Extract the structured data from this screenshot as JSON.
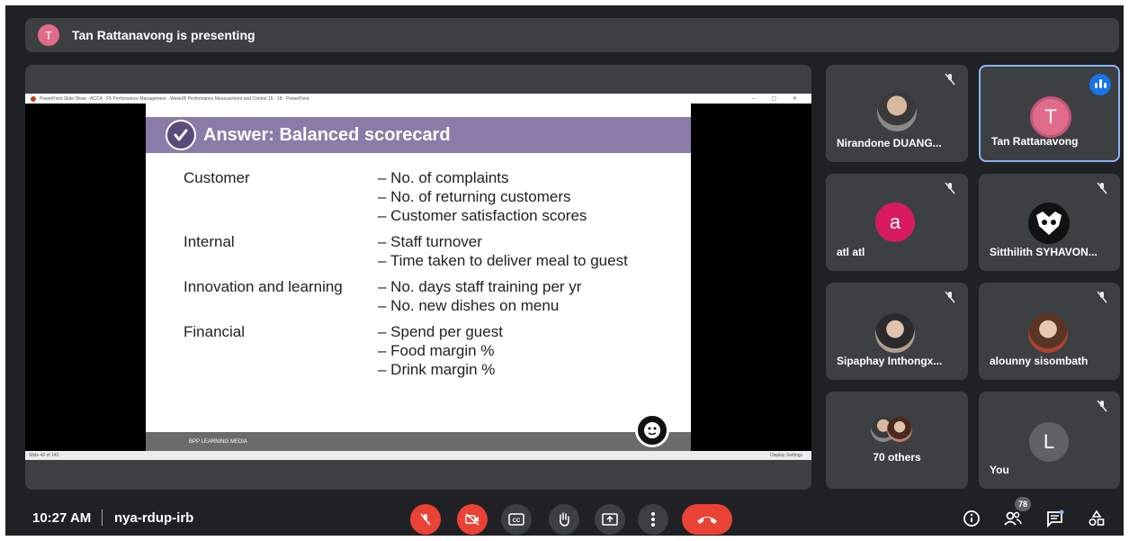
{
  "banner": {
    "avatar_letter": "T",
    "text": "Tan Rattanavong is presenting"
  },
  "ppt": {
    "window_title": "PowerPoint Slide Show  -  ACCA - F5 Performance Management - Week05 Performance Measurement and Control 16 - 18  -  PowerPoint",
    "window_controls": "–  ▢  ✕",
    "status_left": "Slide 42 of 142",
    "status_right": "Display Settings"
  },
  "slide": {
    "title": "Answer: Balanced scorecard",
    "rows": [
      {
        "category": "Customer",
        "items": [
          "– No. of complaints",
          "– No. of returning customers",
          "– Customer satisfaction scores"
        ]
      },
      {
        "category": "Internal",
        "items": [
          "– Staff turnover",
          "– Time taken to deliver meal to guest"
        ]
      },
      {
        "category": "Innovation and learning",
        "items": [
          "– No. days staff training per yr",
          "– No. new dishes on menu"
        ]
      },
      {
        "category": "Financial",
        "items": [
          "– Spend per guest",
          "– Food margin %",
          "– Drink margin %"
        ]
      }
    ],
    "footer": "BPP LEARNING MEDIA"
  },
  "participants": [
    {
      "name": "Nirandone DUANG...",
      "type": "photo",
      "muted": true
    },
    {
      "name": "Tan Rattanavong",
      "type": "letter",
      "letter": "T",
      "color": "#e06c8a",
      "speaking": true
    },
    {
      "name": "atl atl",
      "type": "letter",
      "letter": "a",
      "color": "#d81b60",
      "muted": true
    },
    {
      "name": "Sitthilith SYHAVON...",
      "type": "logo",
      "muted": true
    },
    {
      "name": "Sipaphay Inthongx...",
      "type": "photo",
      "muted": true
    },
    {
      "name": "alounny sisombath",
      "type": "photo",
      "muted": true
    },
    {
      "name": "70 others",
      "type": "group"
    },
    {
      "name": "You",
      "type": "letter",
      "letter": "L",
      "color": "#5f6368",
      "muted": true
    }
  ],
  "bottom": {
    "time": "10:27 AM",
    "meeting_code": "nya-rdup-irb",
    "people_count": "78",
    "colors": {
      "danger": "#ea4335",
      "surface": "#3c4043",
      "accent": "#1a73e8"
    }
  }
}
